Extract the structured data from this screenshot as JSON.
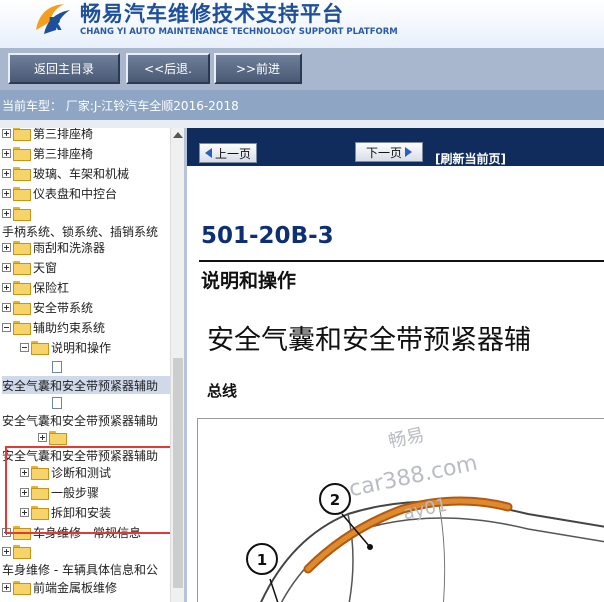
{
  "header": {
    "title_cn": "畅易汽车维修技术支持平台",
    "title_en": "CHANG YI AUTO MAINTENANCE TECHNOLOGY SUPPORT PLATFORM"
  },
  "toolbar": {
    "home": "返回主目录",
    "back": "<<后退.",
    "forward": ">>前进"
  },
  "vehicle_label": "当前车型： 厂家:J-江铃汽车全顺2016-2018",
  "tree": {
    "items": [
      {
        "label": "第三排座椅"
      },
      {
        "label": "第三排座椅"
      },
      {
        "label": "玻璃、车架和机械"
      },
      {
        "label": "仪表盘和中控台"
      },
      {
        "label": "手柄系统、锁系统、插销系统"
      },
      {
        "label": "雨刮和洗涤器"
      },
      {
        "label": "天窗"
      },
      {
        "label": "保险杠"
      },
      {
        "label": "安全带系统"
      },
      {
        "label": "辅助约束系统"
      },
      {
        "label": "说明和操作"
      },
      {
        "label": "安全气囊和安全带预紧器辅助"
      },
      {
        "label": "安全气囊和安全带预紧器辅助"
      },
      {
        "label": "安全气囊和安全带预紧器辅助"
      },
      {
        "label": "诊断和测试"
      },
      {
        "label": "一般步骤"
      },
      {
        "label": "拆卸和安装"
      },
      {
        "label": "车身维修 - 常规信息"
      },
      {
        "label": "车身维修 - 车辆具体信息和公"
      },
      {
        "label": "前端金属板维修"
      }
    ]
  },
  "nav": {
    "prev": "上一页",
    "next": "下一页",
    "refresh": "[刷新当前页]"
  },
  "doc": {
    "code": "501-20B-3",
    "section": "说明和操作",
    "title": "安全气囊和安全带预紧器辅",
    "subhead": "总线"
  },
  "figure": {
    "callout1": "1",
    "callout2": "2",
    "watermark1": "畅易",
    "watermark2": "car388.com",
    "watermark3": "ay01"
  },
  "colors": {
    "brand": "#1d4f9a",
    "toolbar": "#a9b7ce",
    "vehicle_strip": "#8ea5c4",
    "navbar": "#0f2c5c",
    "doc_code": "#0d2f73",
    "highlight_box": "#e53935"
  }
}
